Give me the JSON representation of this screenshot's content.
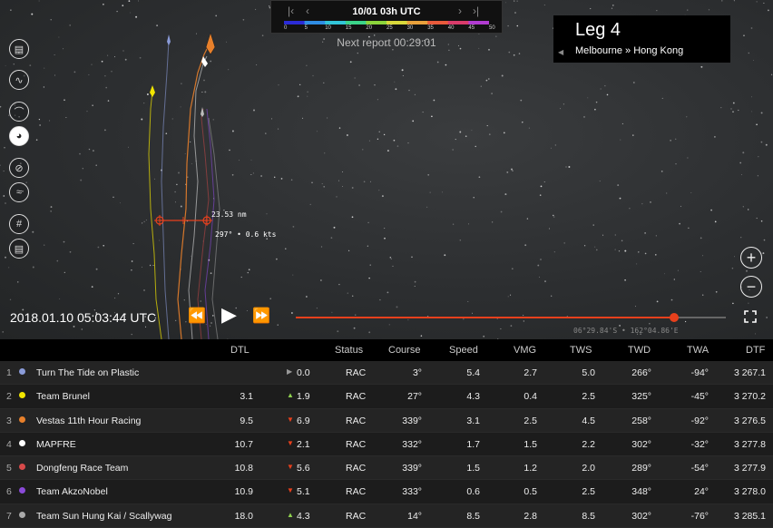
{
  "topbar": {
    "date": "10/01 03h UTC",
    "first_icon": "skip-first",
    "prev_icon": "chevron-left",
    "next_icon": "chevron-right",
    "last_icon": "skip-last",
    "scale_ticks": [
      "0",
      "5",
      "10",
      "15",
      "20",
      "25",
      "30",
      "35",
      "40",
      "45",
      "50"
    ],
    "scale_colors": [
      "#2b2bd6",
      "#2f8de4",
      "#32c5d8",
      "#3bd48a",
      "#8bd43b",
      "#d8d83b",
      "#e8a03b",
      "#e85a3b",
      "#d83b6a",
      "#b03bd0"
    ],
    "next_report": "Next report 00:29:01"
  },
  "leg": {
    "title": "Leg 4",
    "route": "Melbourne » Hong Kong"
  },
  "toolbar": [
    "book-icon",
    "route-icon",
    "curve-icon",
    "boat-icon",
    "compass-icon",
    "wind-icon",
    "grid-icon",
    "ruler-icon"
  ],
  "measure": {
    "distance": "23.53 nm",
    "bearing": "297° • 0.6 kts"
  },
  "playback": {
    "time": "2018.01.10 05:03:44 UTC",
    "progress": 0.88,
    "coords": "06°29.84'S • 162°04.86'E"
  },
  "table": {
    "headers": {
      "dtl": "DTL",
      "status": "Status",
      "course": "Course",
      "speed": "Speed",
      "vmg": "VMG",
      "tws": "TWS",
      "twd": "TWD",
      "twa": "TWA",
      "dtf": "DTF"
    },
    "rows": [
      {
        "rank": "1",
        "color": "#8a9bd8",
        "team": "Turn The Tide on Plastic",
        "dtl": "",
        "change_dir": "flat",
        "change": "0.0",
        "status": "RAC",
        "course": "3°",
        "speed": "5.4",
        "vmg": "2.7",
        "tws": "5.0",
        "twd": "266°",
        "twa": "-94°",
        "dtf": "3 267.1"
      },
      {
        "rank": "2",
        "color": "#f2e600",
        "team": "Team Brunel",
        "dtl": "3.1",
        "change_dir": "up",
        "change": "1.9",
        "status": "RAC",
        "course": "27°",
        "speed": "4.3",
        "vmg": "0.4",
        "tws": "2.5",
        "twd": "325°",
        "twa": "-45°",
        "dtf": "3 270.2"
      },
      {
        "rank": "3",
        "color": "#e8802b",
        "team": "Vestas 11th Hour Racing",
        "dtl": "9.5",
        "change_dir": "down",
        "change": "6.9",
        "status": "RAC",
        "course": "339°",
        "speed": "3.1",
        "vmg": "2.5",
        "tws": "4.5",
        "twd": "258°",
        "twa": "-92°",
        "dtf": "3 276.5"
      },
      {
        "rank": "4",
        "color": "#ffffff",
        "team": "MAPFRE",
        "dtl": "10.7",
        "change_dir": "down",
        "change": "2.1",
        "status": "RAC",
        "course": "332°",
        "speed": "1.7",
        "vmg": "1.5",
        "tws": "2.2",
        "twd": "302°",
        "twa": "-32°",
        "dtf": "3 277.8"
      },
      {
        "rank": "5",
        "color": "#d84a4a",
        "team": "Dongfeng Race Team",
        "dtl": "10.8",
        "change_dir": "down",
        "change": "5.6",
        "status": "RAC",
        "course": "339°",
        "speed": "1.5",
        "vmg": "1.2",
        "tws": "2.0",
        "twd": "289°",
        "twa": "-54°",
        "dtf": "3 277.9"
      },
      {
        "rank": "6",
        "color": "#8a4ad8",
        "team": "Team AkzoNobel",
        "dtl": "10.9",
        "change_dir": "down",
        "change": "5.1",
        "status": "RAC",
        "course": "333°",
        "speed": "0.6",
        "vmg": "0.5",
        "tws": "2.5",
        "twd": "348°",
        "twa": "24°",
        "dtf": "3 278.0"
      },
      {
        "rank": "7",
        "color": "#aaaaaa",
        "team": "Team Sun Hung Kai / Scallywag",
        "dtl": "18.0",
        "change_dir": "up",
        "change": "4.3",
        "status": "RAC",
        "course": "14°",
        "speed": "8.5",
        "vmg": "2.8",
        "tws": "8.5",
        "twd": "302°",
        "twa": "-76°",
        "dtf": "3 285.1"
      }
    ]
  }
}
